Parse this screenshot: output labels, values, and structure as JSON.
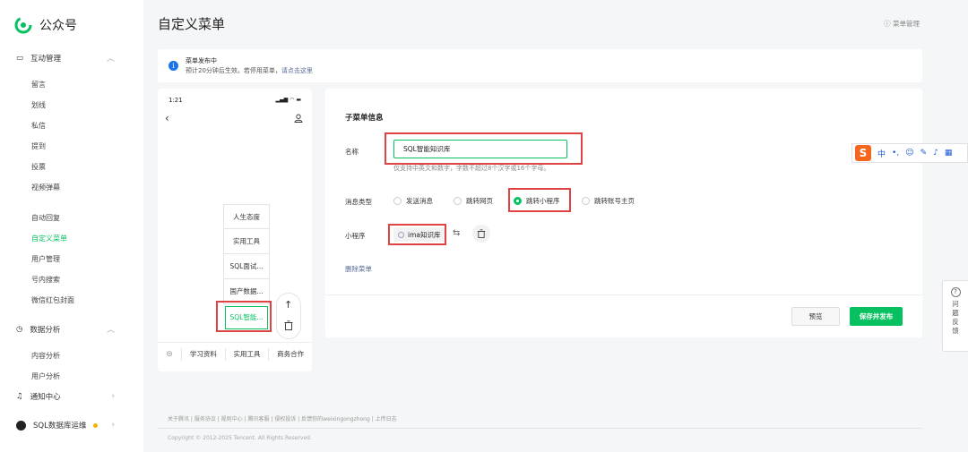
{
  "app": {
    "name": "公众号"
  },
  "sidebar": {
    "groups": [
      {
        "label": "互动管理",
        "icon": "chat-icon"
      },
      {
        "label": "数据分析",
        "icon": "clock-icon"
      },
      {
        "label": "通知中心",
        "icon": "bell-icon"
      }
    ],
    "interaction_items": [
      "留言",
      "划线",
      "私信",
      "提到",
      "投票",
      "视频弹幕"
    ],
    "feature_items": [
      "自动回复",
      "自定义菜单",
      "用户管理",
      "号内搜索",
      "微信红包封面"
    ],
    "analysis_items": [
      "内容分析",
      "用户分析"
    ],
    "account": "SQL数据库运维"
  },
  "header": {
    "title": "自定义菜单",
    "menu_mgmt": "菜单管理"
  },
  "notice": {
    "line1": "菜单发布中",
    "line2_prefix": "预计20分钟后生效。若停用菜单，",
    "line2_link": "请点击这里"
  },
  "phone": {
    "time": "1:21",
    "submenus": [
      "人生态度",
      "实用工具",
      "SQL面试...",
      "国产数据...",
      "SQL智能..."
    ],
    "bottom_tabs": [
      "学习资料",
      "实用工具",
      "商务合作"
    ]
  },
  "panel": {
    "section_title": "子菜单信息",
    "name_label": "名称",
    "name_value": "SQL智能知识库",
    "name_hint": "仅支持中英文和数字，字数不超过8个汉字或16个字母。",
    "type_label": "消息类型",
    "types": [
      "发送消息",
      "跳转网页",
      "跳转小程序",
      "跳转账号主页"
    ],
    "selected_type": "跳转小程序",
    "mini_label": "小程序",
    "mini_value": "ima知识库",
    "delete_menu": "删除菜单",
    "preview_btn": "预览",
    "save_btn": "保存并发布"
  },
  "ime": {
    "logo": "S",
    "lang": "中"
  },
  "feedback": {
    "label": [
      "问",
      "题",
      "反",
      "馈"
    ]
  },
  "footer": {
    "links": "关于腾讯 | 服务协议 | 规则中心 | 腾讯客服 | 侵权投诉 | 反馈你的weixingongzhong | 上传日志",
    "copyright": "Copyright © 2012-2025 Tencent. All Rights Reserved."
  },
  "colors": {
    "accent": "#07c160",
    "highlight": "#e04343",
    "link": "#576b95",
    "info": "#1a73e8"
  }
}
